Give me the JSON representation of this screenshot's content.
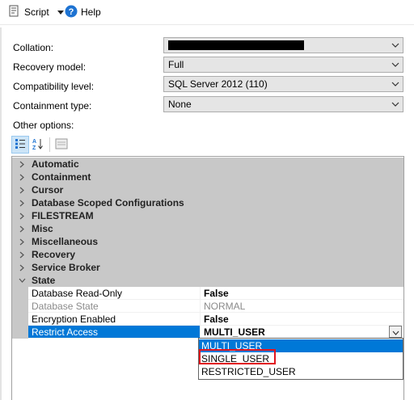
{
  "toolbar": {
    "script_label": "Script",
    "help_label": "Help"
  },
  "form": {
    "collation": {
      "label": "Collation:",
      "value": ""
    },
    "recovery_model": {
      "label": "Recovery model:",
      "value": "Full"
    },
    "compatibility_level": {
      "label": "Compatibility level:",
      "value": "SQL Server 2012 (110)"
    },
    "containment_type": {
      "label": "Containment type:",
      "value": "None"
    },
    "other_options_label": "Other options:"
  },
  "property_grid": {
    "categories": [
      "Automatic",
      "Containment",
      "Cursor",
      "Database Scoped Configurations",
      "FILESTREAM",
      "Misc",
      "Miscellaneous",
      "Recovery",
      "Service Broker",
      "State"
    ],
    "expanded_category": "State",
    "state_properties": [
      {
        "name": "Database Read-Only",
        "value": "False"
      },
      {
        "name": "Database State",
        "value": "NORMAL"
      },
      {
        "name": "Encryption Enabled",
        "value": "False"
      },
      {
        "name": "Restrict Access",
        "value": "MULTI_USER"
      }
    ]
  },
  "dropdown": {
    "options": [
      "MULTI_USER",
      "SINGLE_USER",
      "RESTRICTED_USER"
    ],
    "highlighted": "MULTI_USER",
    "marked": "SINGLE_USER"
  },
  "colors": {
    "selection": "#0078d7",
    "category_bg": "#c8c8c8",
    "marker": "#e0141e"
  }
}
